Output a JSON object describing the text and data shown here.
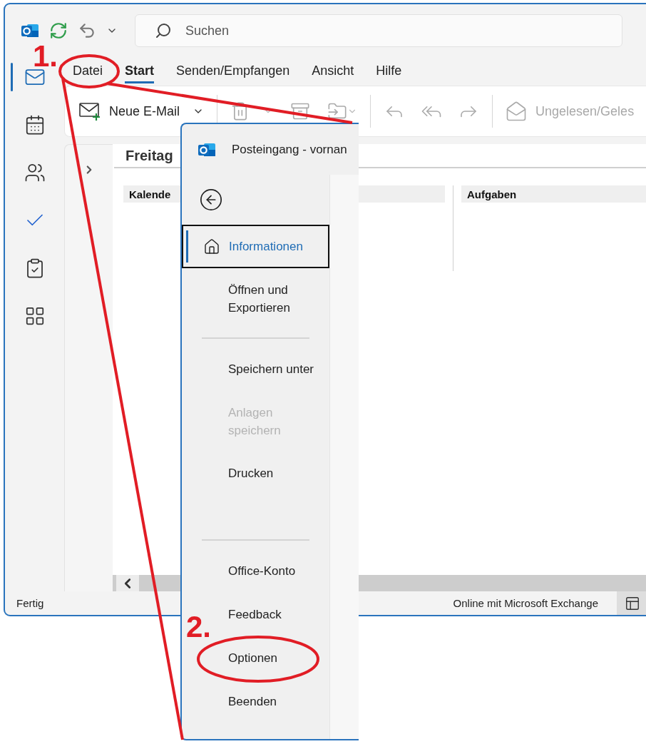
{
  "title_bar": {
    "search": {
      "placeholder": "Suchen"
    }
  },
  "nav_rail": [
    {
      "selected": true
    },
    {
      "selected": false
    },
    {
      "selected": false
    },
    {
      "selected": false
    },
    {
      "selected": false
    },
    {
      "selected": false
    }
  ],
  "tabs": [
    {
      "label": "Datei",
      "selected": false
    },
    {
      "label": "Start",
      "selected": true
    },
    {
      "label": "Senden/Empfangen",
      "selected": false
    },
    {
      "label": "Ansicht",
      "selected": false
    },
    {
      "label": "Hilfe",
      "selected": false
    }
  ],
  "ribbon": {
    "new_mail": {
      "label": "Neue E-Mail"
    },
    "read_toggle": {
      "label": "Ungelesen/Geles",
      "disabled": true
    }
  },
  "content": {
    "heading": "Freitag",
    "headers": [
      "Kalende",
      "Aufgaben"
    ]
  },
  "status_bar": {
    "left": "Fertig",
    "right": "Online mit Microsoft Exchange"
  },
  "backstage": {
    "title": "Posteingang - vornan",
    "items": [
      {
        "kind": "home",
        "label": "Informationen",
        "selected": true,
        "disabled": false
      },
      {
        "kind": "item",
        "label": "Öffnen und Exportieren",
        "selected": false,
        "disabled": false
      },
      {
        "kind": "divider"
      },
      {
        "kind": "item",
        "label": "Speichern unter",
        "selected": false,
        "disabled": false
      },
      {
        "kind": "item",
        "label": "Anlagen speichern",
        "selected": false,
        "disabled": true
      },
      {
        "kind": "item",
        "label": "Drucken",
        "selected": false,
        "disabled": false
      },
      {
        "kind": "divider"
      },
      {
        "kind": "item",
        "label": "Office-Konto",
        "selected": false,
        "disabled": false
      },
      {
        "kind": "item",
        "label": "Feedback",
        "selected": false,
        "disabled": false
      },
      {
        "kind": "item",
        "label": "Optionen",
        "selected": false,
        "disabled": false
      },
      {
        "kind": "item",
        "label": "Beenden",
        "selected": false,
        "disabled": false
      }
    ]
  },
  "annotations": [
    {
      "label": "1."
    },
    {
      "label": "2."
    }
  ]
}
